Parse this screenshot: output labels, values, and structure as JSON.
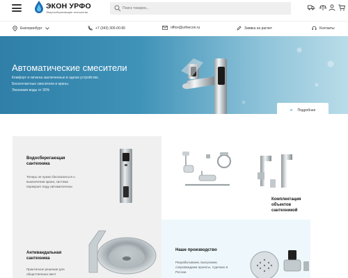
{
  "header": {
    "logo_title": "ЭКОН УРФО",
    "logo_subtitle": "Энергосберегающие технологии",
    "search_placeholder": "Поиск товаров...",
    "icons": [
      "menu-icon",
      "search-icon",
      "truck-icon",
      "scales-icon",
      "user-icon",
      "cart-icon"
    ]
  },
  "info_bar": {
    "city": "Екатеринбург",
    "phone": "+7 (343) 305-00-95",
    "email": "office@urfoecon.ru",
    "request": "Заявка на расчет",
    "contacts": "Контакты"
  },
  "banner": {
    "title": "Автоматические смесители",
    "lines": [
      "Комфорт и гигиена заключенные в одном устройстве.",
      "Бесконтактные смесители и краны.",
      "Экономия воды от 30%"
    ],
    "button_label": "Подробнее",
    "button_arrows": "›››"
  },
  "cards": [
    {
      "title": [
        "Водосберегающая",
        "сантехника"
      ],
      "text": [
        "Теперь не нужно беспокоиться о",
        "выключении крана, система",
        "перекроет воду автоматически"
      ]
    },
    {
      "title": [
        "Комплектация объектов",
        "сантехникой"
      ],
      "text": []
    },
    {
      "title": [
        "Антивандальная",
        "сантехника"
      ],
      "text": [
        "Практичное решение для",
        "общественных мест"
      ]
    },
    {
      "title": [
        "Наше производство"
      ],
      "text": [
        "Разрабатываем, выпускаем,",
        "сопровождаем проекты. Сделано в",
        "России."
      ]
    }
  ],
  "colors": {
    "accent": "#2b8fc0",
    "banner_start": "#2f7fa8",
    "banner_end": "#b9dce9",
    "card_grey": "#f0f0f0",
    "card_light_blue": "#eef8fc"
  }
}
